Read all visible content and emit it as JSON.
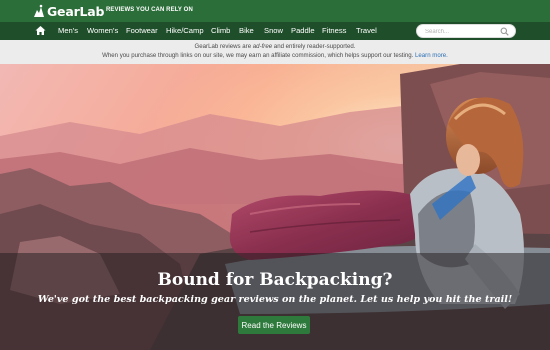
{
  "header": {
    "logo_text": "GearLab",
    "tagline": "REVIEWS YOU CAN RELY ON",
    "brand_color": "#2b6e3a",
    "nav_color": "#1f4f2a"
  },
  "nav": {
    "home_icon": "home-icon",
    "items": [
      "Men's",
      "Women's",
      "Footwear",
      "Hike/Camp",
      "Climb",
      "Bike",
      "Snow",
      "Paddle",
      "Fitness",
      "Travel"
    ],
    "search_placeholder": "Search..."
  },
  "disclosure": {
    "line1_a": "GearLab reviews are ",
    "line1_em": "ad-free",
    "line1_b": " and entirely reader-supported.",
    "line2": "When you purchase through links on our site, we may earn an affiliate commission, which helps support our testing.",
    "link": "Learn more."
  },
  "hero": {
    "title": "Bound for Backpacking?",
    "subtitle": "We've got the best backpacking gear reviews on the planet. Let us help you hit the trail!",
    "button": "Read the Reviews",
    "button_color": "#2e7a3c"
  }
}
